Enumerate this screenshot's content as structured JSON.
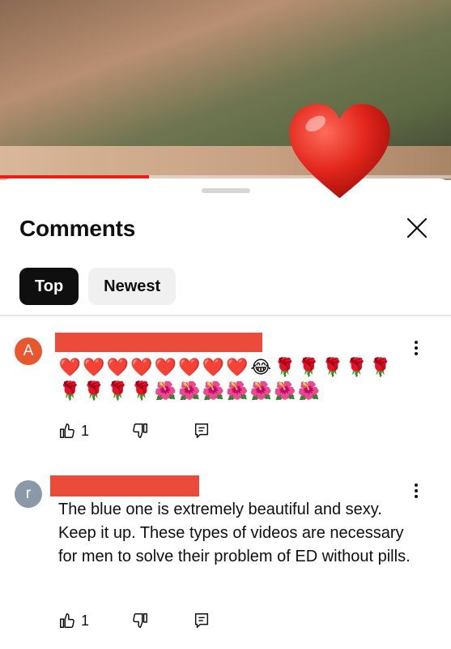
{
  "video": {
    "progress_fraction": 0.33
  },
  "sheet": {
    "title": "Comments"
  },
  "tabs": [
    {
      "label": "Top",
      "active": true
    },
    {
      "label": "Newest",
      "active": false
    }
  ],
  "comments": [
    {
      "avatar_letter": "A",
      "avatar_color": "#e8572e",
      "emoji_line_1": [
        "❤️",
        "❤️",
        "❤️",
        "❤️",
        "❤️",
        "❤️",
        "❤️",
        "❤️",
        "😂",
        "🌹",
        "🌹",
        "🌹",
        "🌹",
        "🌹"
      ],
      "emoji_line_2": [
        "🌹",
        "🌹",
        "🌹",
        "🌹",
        "🌺",
        "🌺",
        "🌺",
        "🌺",
        "🌺",
        "🌺",
        "🌺"
      ],
      "likes": "1"
    },
    {
      "avatar_letter": "r",
      "avatar_color": "#8a98a8",
      "text": "The blue one is extremely beautiful and sexy. Keep it up. These types of videos are necessary for men to solve their problem of ED without pills.",
      "likes": "1"
    }
  ],
  "colors": {
    "accent_red": "#ea4b3a",
    "chip_active_bg": "#0f0f0f",
    "chip_inactive_bg": "#f0f0f0"
  }
}
